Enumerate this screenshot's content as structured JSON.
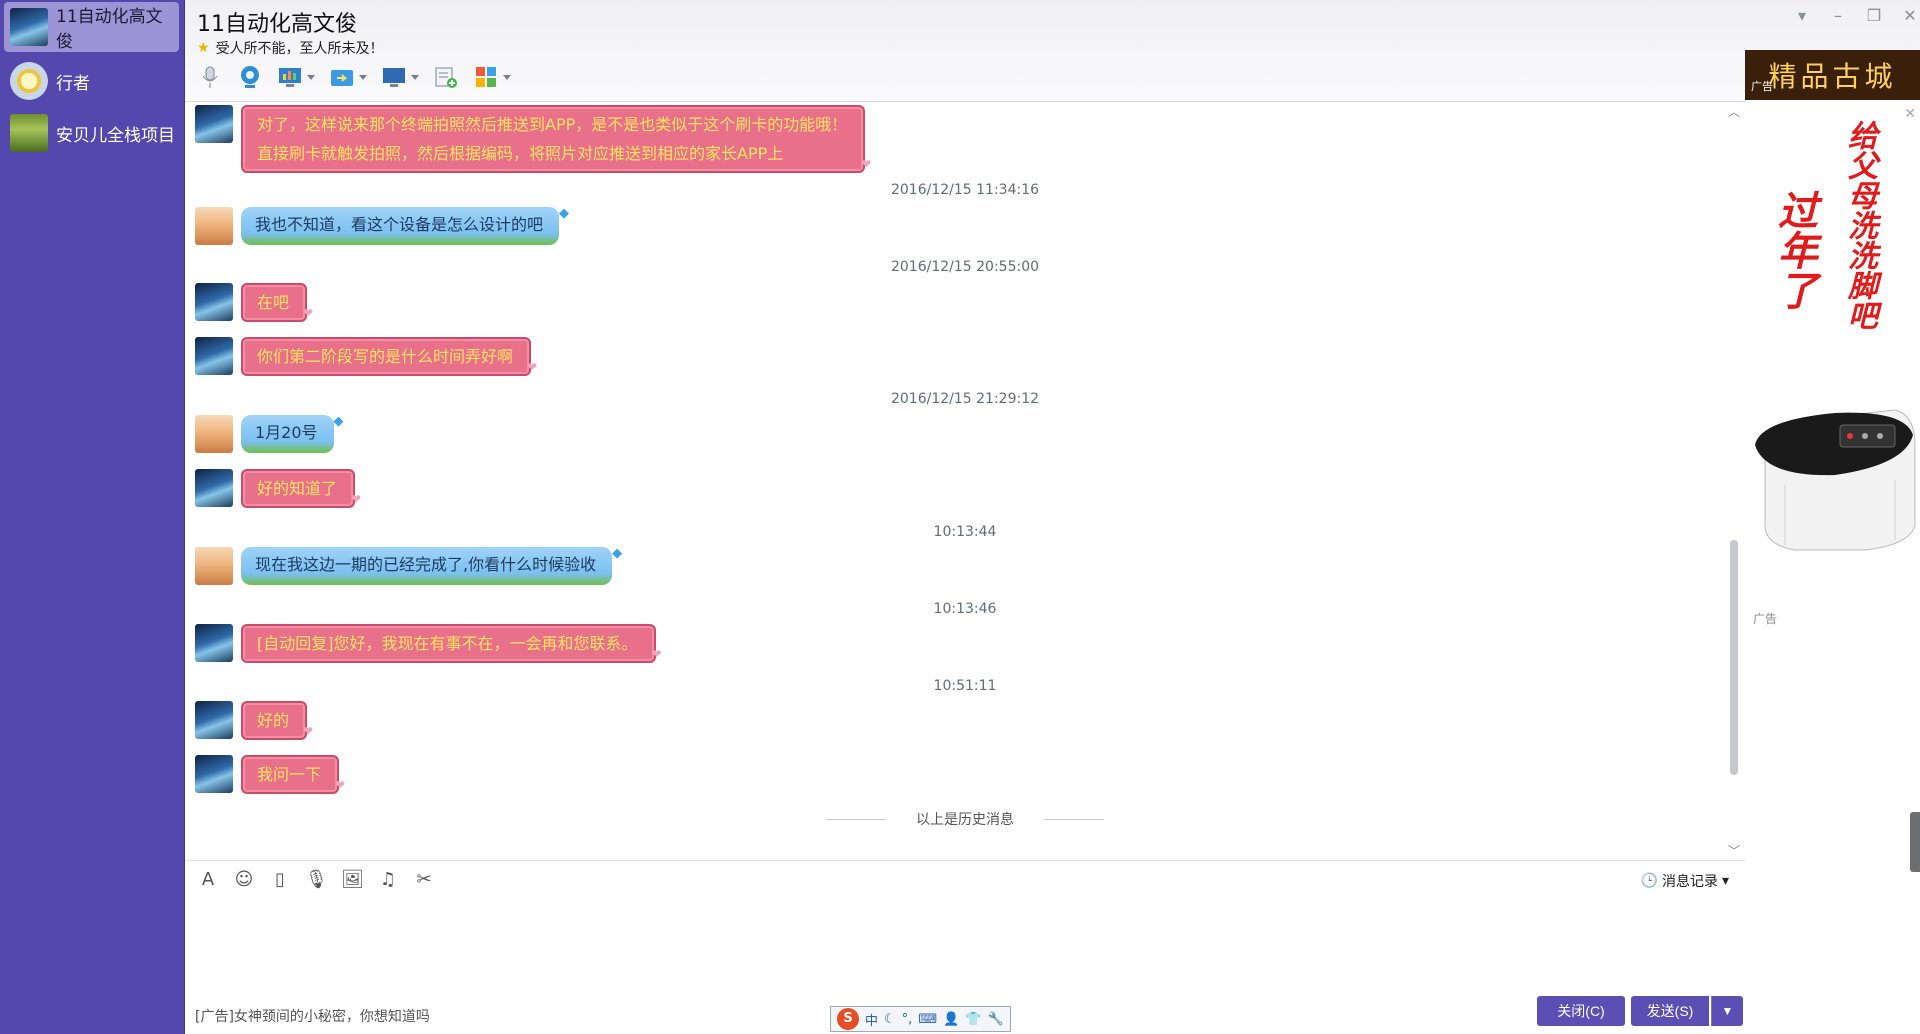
{
  "sidebar": {
    "items": [
      {
        "label": "11自动化高文俊",
        "active": true
      },
      {
        "label": "行者",
        "active": false
      },
      {
        "label": "安贝儿全栈项目",
        "active": false
      }
    ]
  },
  "header": {
    "contact_name": "11自动化高文俊",
    "signature": "受人所不能，至人所未及！"
  },
  "messages": [
    {
      "side": "me",
      "style": "pink",
      "lines": [
        "对了，这样说来那个终端拍照然后推送到APP，是不是也类似于这个刷卡的功能哦！",
        "直接刷卡就触发拍照，然后根据编码，将照片对应推送到相应的家长APP上"
      ]
    },
    {
      "type": "timestamp",
      "text": "2016/12/15 11:34:16"
    },
    {
      "side": "peer",
      "style": "blue",
      "lines": [
        "我也不知道，看这个设备是怎么设计的吧"
      ]
    },
    {
      "type": "timestamp",
      "text": "2016/12/15 20:55:00"
    },
    {
      "side": "me",
      "style": "pink",
      "lines": [
        "在吧"
      ]
    },
    {
      "side": "me",
      "style": "pink",
      "lines": [
        "你们第二阶段写的是什么时间弄好啊"
      ]
    },
    {
      "type": "timestamp",
      "text": "2016/12/15 21:29:12"
    },
    {
      "side": "peer",
      "style": "blue",
      "lines": [
        "1月20号"
      ]
    },
    {
      "side": "me",
      "style": "pink",
      "lines": [
        "好的知道了"
      ]
    },
    {
      "type": "timestamp",
      "text": "10:13:44"
    },
    {
      "side": "peer",
      "style": "blue",
      "lines": [
        "现在我这边一期的已经完成了,你看什么时候验收"
      ]
    },
    {
      "type": "timestamp",
      "text": "10:13:46"
    },
    {
      "side": "me",
      "style": "pink",
      "lines": [
        "[自动回复]您好，我现在有事不在，一会再和您联系。"
      ]
    },
    {
      "type": "timestamp",
      "text": "10:51:11"
    },
    {
      "side": "me",
      "style": "pink",
      "lines": [
        "好的"
      ]
    },
    {
      "side": "me",
      "style": "pink",
      "lines": [
        "我问一下"
      ]
    }
  ],
  "history_label": "以上是历史消息",
  "input": {
    "history_button": "消息记录",
    "ad_text": "[广告]女神颈间的小秘密，你想知道吗",
    "close_button": "关闭(C)",
    "send_button": "发送(S)",
    "ime_chars": [
      "中",
      "☾",
      "°,",
      "⌨",
      "👤",
      "👕",
      "🔧"
    ]
  },
  "ad": {
    "banner_text": "精品古城",
    "banner_tag": "广告",
    "slogan_big": "过年了",
    "slogan_small": "给父母洗洗脚吧",
    "product_tag": "广告"
  },
  "colors": {
    "sidebar": "#5447ad",
    "active_item": "#9c94d4",
    "pink_bubble": "#e9708a",
    "blue_bubble": "#8fcaf5",
    "button": "#5b4fb3"
  }
}
